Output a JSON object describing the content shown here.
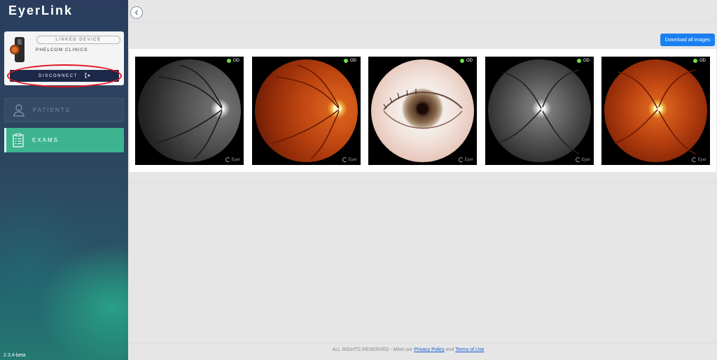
{
  "app": {
    "logo": "EyerLink",
    "version": "2.3.4-beta"
  },
  "device": {
    "linked_label": "LINKED DEVICE",
    "name": "PHELCOM CLINICS",
    "disconnect_label": "DISCONNECT"
  },
  "nav": {
    "patients_label": "PATIENTS",
    "exams_label": "EXAMS",
    "active": "EXAMS"
  },
  "toolbar": {
    "download_label": "Download all images"
  },
  "images": [
    {
      "type": "red-free fundus",
      "eye_label": "OD",
      "watermark": "Eyer"
    },
    {
      "type": "color fundus",
      "eye_label": "OD",
      "watermark": "Eyer"
    },
    {
      "type": "anterior segment",
      "eye_label": "OD",
      "watermark": "Eyer"
    },
    {
      "type": "red-free fundus",
      "eye_label": "OD",
      "watermark": "Eyer"
    },
    {
      "type": "color fundus",
      "eye_label": "OD",
      "watermark": "Eyer"
    }
  ],
  "footer": {
    "prefix": "ALL RIGHTS RESERVED - Meet our",
    "privacy_link": "Privacy Policy",
    "conjunction": "and",
    "terms_link": "Terms of Use"
  },
  "colors": {
    "accent_active": "#3db48f",
    "primary_button": "#1a7ff0",
    "disconnect_button": "#1c2848",
    "highlight": "#e0141e",
    "status_dot": "#6fe04e"
  }
}
